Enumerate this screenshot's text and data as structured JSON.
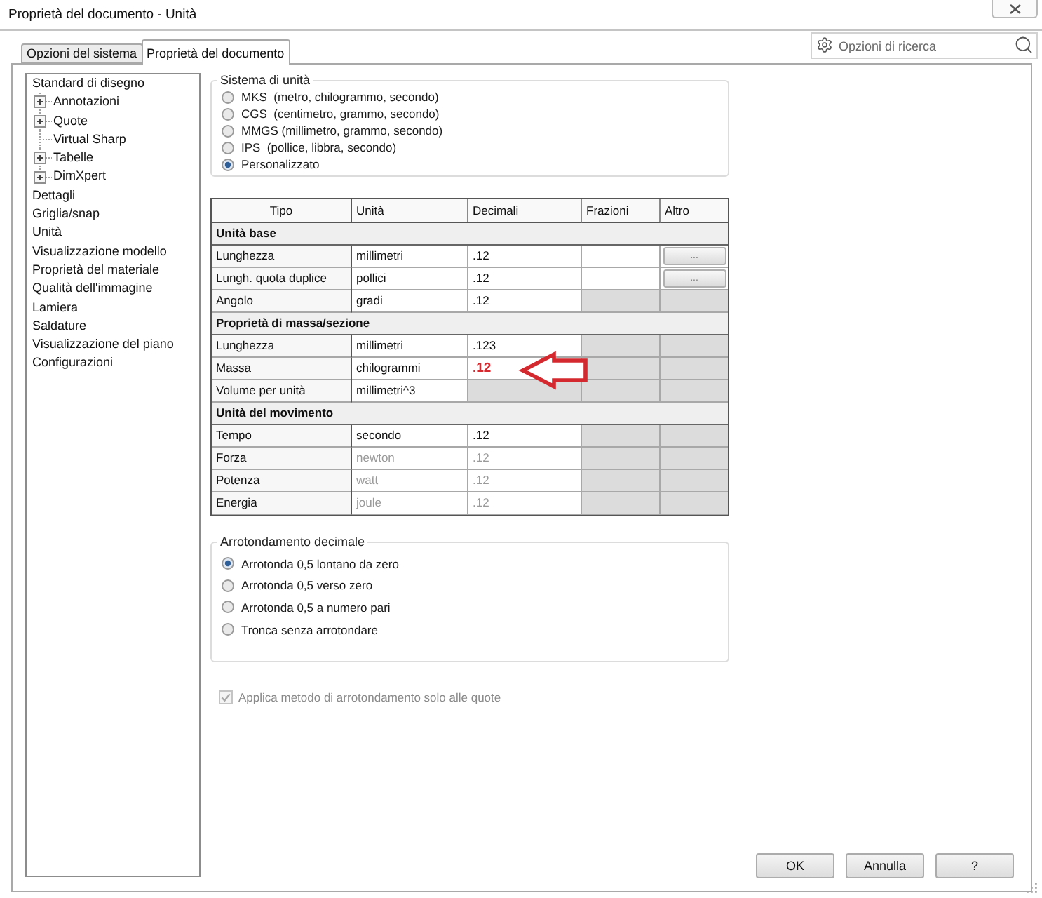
{
  "window": {
    "title": "Proprietà del documento - Unità"
  },
  "tabs": [
    {
      "label": "Opzioni del sistema",
      "selected": false
    },
    {
      "label": "Proprietà del documento",
      "selected": true
    }
  ],
  "search": {
    "placeholder": "Opzioni di ricerca"
  },
  "sidebar": {
    "items": [
      {
        "label": "Standard di disegno",
        "children": [
          {
            "label": "Annotazioni",
            "expandable": true
          },
          {
            "label": "Quote",
            "expandable": true
          },
          {
            "label": "Virtual Sharp",
            "expandable": false
          },
          {
            "label": "Tabelle",
            "expandable": true
          },
          {
            "label": "DimXpert",
            "expandable": true
          }
        ]
      },
      {
        "label": "Dettagli"
      },
      {
        "label": "Griglia/snap"
      },
      {
        "label": "Unità"
      },
      {
        "label": "Visualizzazione modello"
      },
      {
        "label": "Proprietà del materiale"
      },
      {
        "label": "Qualità dell'immagine"
      },
      {
        "label": "Lamiera"
      },
      {
        "label": "Saldature"
      },
      {
        "label": "Visualizzazione del piano"
      },
      {
        "label": "Configurazioni"
      }
    ]
  },
  "unit_system": {
    "title": "Sistema di unità",
    "options": [
      {
        "label": "MKS  (metro, chilogrammo, secondo)",
        "selected": false
      },
      {
        "label": "CGS  (centimetro, grammo, secondo)",
        "selected": false
      },
      {
        "label": "MMGS (millimetro, grammo, secondo)",
        "selected": false
      },
      {
        "label": "IPS  (pollice, libbra, secondo)",
        "selected": false
      },
      {
        "label": "Personalizzato",
        "selected": true
      }
    ]
  },
  "table": {
    "columns": [
      "Tipo",
      "Unità",
      "Decimali",
      "Frazioni",
      "Altro"
    ],
    "rows": [
      {
        "kind": "section",
        "label": "Unità base"
      },
      {
        "kind": "unit",
        "type": "Lunghezza",
        "unit": "millimetri",
        "decimals": ".12",
        "fractions_enabled": true,
        "other": "...",
        "disabled": false,
        "highlighted": false
      },
      {
        "kind": "unit",
        "type": "Lungh. quota duplice",
        "unit": "pollici",
        "decimals": ".12",
        "fractions_enabled": true,
        "other": "...",
        "disabled": false,
        "highlighted": false
      },
      {
        "kind": "unit",
        "type": "Angolo",
        "unit": "gradi",
        "decimals": ".12",
        "fractions_enabled": false,
        "disabled": false,
        "highlighted": false
      },
      {
        "kind": "section",
        "label": "Proprietà di massa/sezione"
      },
      {
        "kind": "unit",
        "type": "Lunghezza",
        "unit": "millimetri",
        "decimals": ".123",
        "fractions_enabled": false,
        "disabled": false,
        "highlighted": false
      },
      {
        "kind": "unit",
        "type": "Massa",
        "unit": "chilogrammi",
        "decimals": ".12",
        "fractions_enabled": false,
        "disabled": false,
        "highlighted": true
      },
      {
        "kind": "unit",
        "type": "Volume per unità",
        "unit": "millimetri^3",
        "fractions_enabled": false,
        "disabled": false,
        "highlighted": false
      },
      {
        "kind": "section",
        "label": "Unità del movimento"
      },
      {
        "kind": "unit",
        "type": "Tempo",
        "unit": "secondo",
        "decimals": ".12",
        "fractions_enabled": false,
        "disabled": false,
        "highlighted": false
      },
      {
        "kind": "unit",
        "type": "Forza",
        "unit": "newton",
        "decimals": ".12",
        "fractions_enabled": false,
        "disabled": true,
        "highlighted": false
      },
      {
        "kind": "unit",
        "type": "Potenza",
        "unit": "watt",
        "decimals": ".12",
        "fractions_enabled": false,
        "disabled": true,
        "highlighted": false
      },
      {
        "kind": "unit",
        "type": "Energia",
        "unit": "joule",
        "decimals": ".12",
        "fractions_enabled": false,
        "disabled": true,
        "highlighted": false
      }
    ]
  },
  "rounding": {
    "title": "Arrotondamento decimale",
    "options": [
      {
        "label": "Arrotonda 0,5 lontano da zero",
        "selected": true
      },
      {
        "label": "Arrotonda 0,5 verso zero",
        "selected": false
      },
      {
        "label": "Arrotonda 0,5 a numero pari",
        "selected": false
      },
      {
        "label": "Tronca senza arrotondare",
        "selected": false
      }
    ]
  },
  "apply_rounding": {
    "label": "Applica metodo di arrotondamento solo alle quote",
    "checked": true,
    "disabled": true
  },
  "buttons": [
    "OK",
    "Annulla",
    "?"
  ]
}
